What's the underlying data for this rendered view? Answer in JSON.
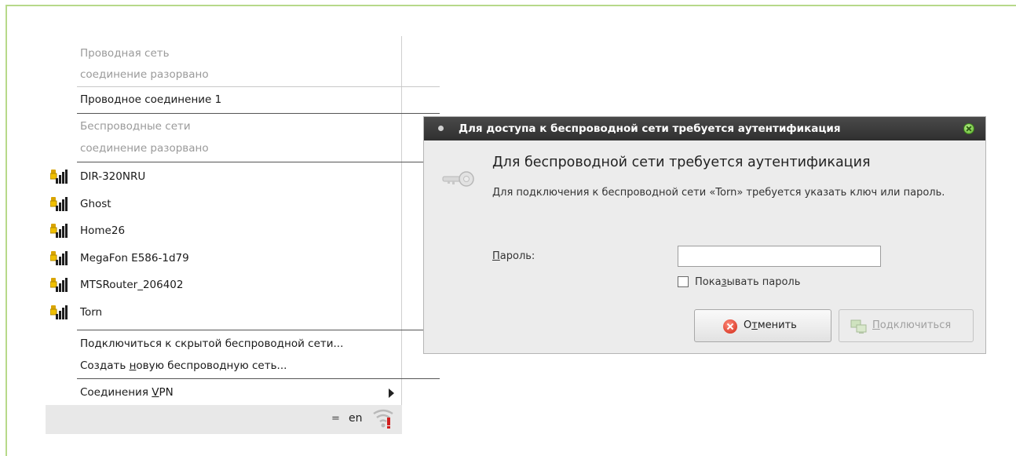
{
  "menu": {
    "wired_header": "Проводная сеть",
    "wired_status": "соединение разорвано",
    "wired_connection": "Проводное соединение 1",
    "wireless_header": "Беспроводные сети",
    "wireless_status": "соединение разорвано",
    "networks": [
      {
        "name": "DIR-320NRU",
        "icon": "wifi-signal-lock-icon"
      },
      {
        "name": "Ghost",
        "icon": "wifi-signal-lock-icon"
      },
      {
        "name": "Home26",
        "icon": "wifi-signal-lock-icon"
      },
      {
        "name": "MegaFon E586-1d79",
        "icon": "wifi-signal-lock-icon"
      },
      {
        "name": "MTSRouter_206402",
        "icon": "wifi-signal-lock-icon"
      },
      {
        "name": "Torn",
        "icon": "wifi-signal-lock-icon"
      }
    ],
    "connect_hidden": "Подключиться к скрытой беспроводной сети...",
    "create_new_pre": "Создать ",
    "create_new_ul": "н",
    "create_new_post": "овую беспроводную сеть...",
    "vpn_pre": "Соединения ",
    "vpn_ul": "V",
    "vpn_post": "PN"
  },
  "tray": {
    "separator": "=",
    "layout": "en"
  },
  "dialog": {
    "title": "Для доступа к беспроводной сети требуется аутентификация",
    "heading": "Для беспроводной сети требуется аутентификация",
    "description": "Для подключения к беспроводной сети «Torn» требуется указать ключ или пароль.",
    "password_label_ul": "П",
    "password_label_rest": "ароль:",
    "password_value": "",
    "show_password_pre": "Пока",
    "show_password_ul": "з",
    "show_password_post": "ывать пароль",
    "cancel_pre": "О",
    "cancel_ul": "т",
    "cancel_post": "менить",
    "connect_ul": "П",
    "connect_post": "одключиться"
  },
  "colors": {
    "frame_border": "#b7d98a",
    "titlebar": "#3a3a3a",
    "dialog_bg": "#ececec",
    "close_button": "#5fb62d",
    "cancel_icon": "#d02714"
  }
}
